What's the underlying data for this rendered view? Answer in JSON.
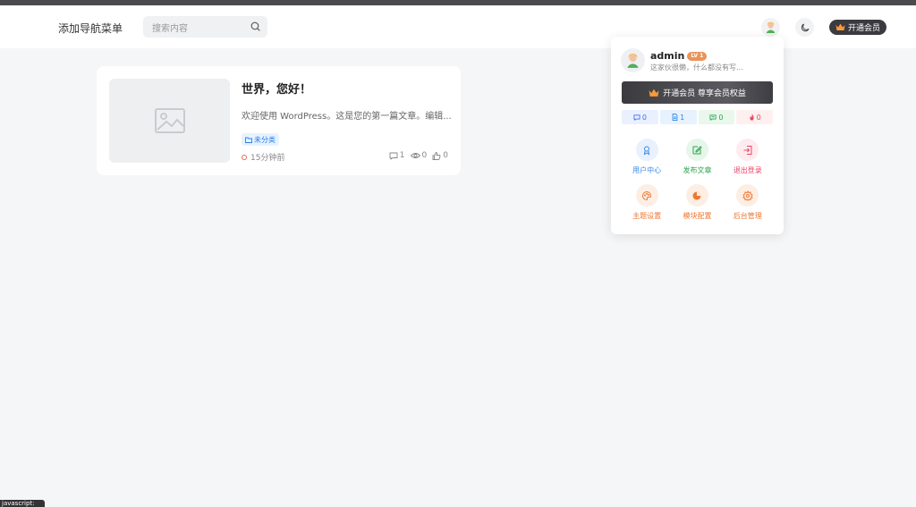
{
  "header": {
    "nav_label": "添加导航菜单",
    "search_placeholder": "搜索内容",
    "vip_label": "开通会员"
  },
  "post": {
    "title": "世界，您好！",
    "excerpt": "欢迎使用 WordPress。这是您的第一篇文章。编辑...",
    "category": "未分类",
    "time": "15分钟前",
    "comments": "1",
    "views": "0",
    "likes": "0"
  },
  "user_menu": {
    "name": "admin",
    "level": "LV 1",
    "bio": "这家伙很懒，什么都没有写...",
    "vip_label": "开通会员 尊享会员权益",
    "counts": [
      {
        "icon": "comment-icon",
        "value": "0",
        "color": "#3c6ff0"
      },
      {
        "icon": "post-icon",
        "value": "1",
        "color": "#2a86e8"
      },
      {
        "icon": "message-icon",
        "value": "0",
        "color": "#2da44e"
      },
      {
        "icon": "fire-icon",
        "value": "0",
        "color": "#ee4455"
      }
    ],
    "items": [
      {
        "label": "用户中心",
        "icon": "user-center-icon",
        "color": "#3a88e6",
        "bg": "#e8f1fd"
      },
      {
        "label": "发布文章",
        "icon": "edit-icon",
        "color": "#2da44e",
        "bg": "#e6f6ea"
      },
      {
        "label": "退出登录",
        "icon": "logout-icon",
        "color": "#ee4466",
        "bg": "#fdebef"
      },
      {
        "label": "主题设置",
        "icon": "palette-icon",
        "color": "#ee7733",
        "bg": "#fdeee3"
      },
      {
        "label": "模块配置",
        "icon": "module-icon",
        "color": "#ee7733",
        "bg": "#fdeee3"
      },
      {
        "label": "后台管理",
        "icon": "gear-icon",
        "color": "#ee7733",
        "bg": "#fdeee3"
      }
    ]
  },
  "statusbar": {
    "text": "javascript:"
  }
}
